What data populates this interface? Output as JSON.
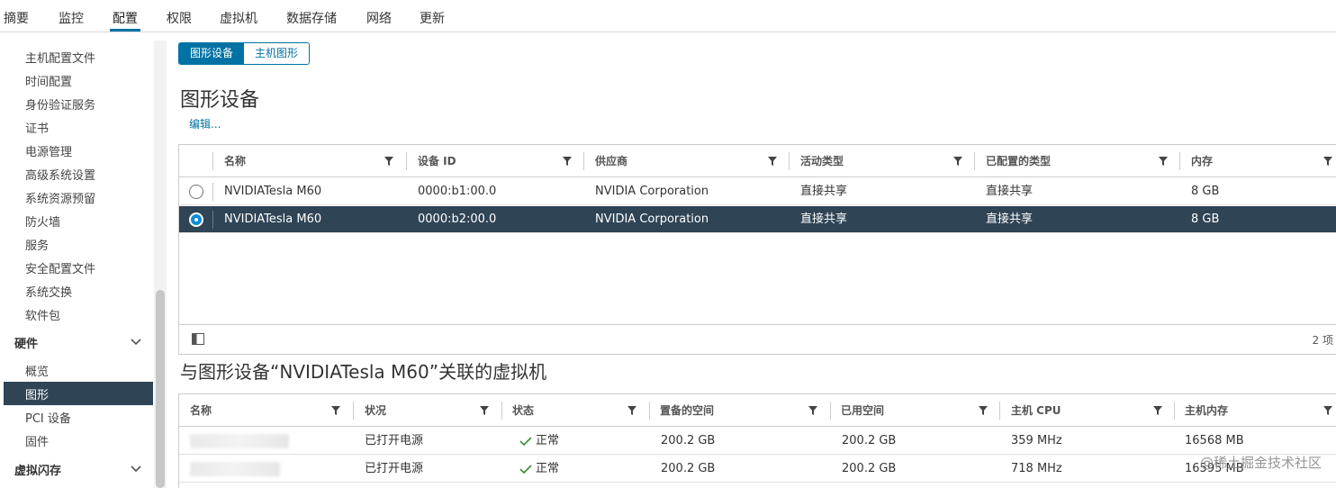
{
  "tabs": [
    "摘要",
    "监控",
    "配置",
    "权限",
    "虚拟机",
    "数据存储",
    "网络",
    "更新"
  ],
  "active_tab": "配置",
  "sidebar": {
    "items": [
      "主机配置文件",
      "时间配置",
      "身份验证服务",
      "证书",
      "电源管理",
      "高级系统设置",
      "系统资源预留",
      "防火墙",
      "服务",
      "安全配置文件",
      "系统交换",
      "软件包"
    ],
    "hardware_group": "硬件",
    "hardware_items": [
      "概览",
      "图形",
      "PCI 设备",
      "固件"
    ],
    "selected": "图形",
    "vmem_group": "虚拟闪存"
  },
  "segmented": {
    "graphics_devices": "图形设备",
    "host_graphics": "主机图形"
  },
  "section1": {
    "title": "图形设备",
    "edit_link": "编辑...",
    "columns": [
      "名称",
      "设备 ID",
      "供应商",
      "活动类型",
      "已配置的类型",
      "内存"
    ],
    "rows": [
      {
        "name": "NVIDIATesla M60",
        "device_id": "0000:b1:00.0",
        "vendor": "NVIDIA Corporation",
        "active_type": "直接共享",
        "configured_type": "直接共享",
        "memory": "8 GB",
        "selected": false
      },
      {
        "name": "NVIDIATesla M60",
        "device_id": "0000:b2:00.0",
        "vendor": "NVIDIA Corporation",
        "active_type": "直接共享",
        "configured_type": "直接共享",
        "memory": "8 GB",
        "selected": true
      }
    ],
    "count": "2 项"
  },
  "section2": {
    "title": "与图形设备“NVIDIATesla M60”关联的虚拟机",
    "columns": [
      "名称",
      "状况",
      "状态",
      "置备的空间",
      "已用空间",
      "主机 CPU",
      "主机内存"
    ],
    "rows": [
      {
        "condition": "已打开电源",
        "status": "正常",
        "provisioned": "200.2 GB",
        "used": "200.2 GB",
        "cpu": "359 MHz",
        "memory": "16568 MB"
      },
      {
        "condition": "已打开电源",
        "status": "正常",
        "provisioned": "200.2 GB",
        "used": "200.2 GB",
        "cpu": "718 MHz",
        "memory": "16595 MB"
      }
    ]
  },
  "watermark": "@稀土掘金技术社区",
  "colors": {
    "accent": "#0072a3",
    "selected_row": "#2f4455",
    "check": "#3c8b3c"
  }
}
